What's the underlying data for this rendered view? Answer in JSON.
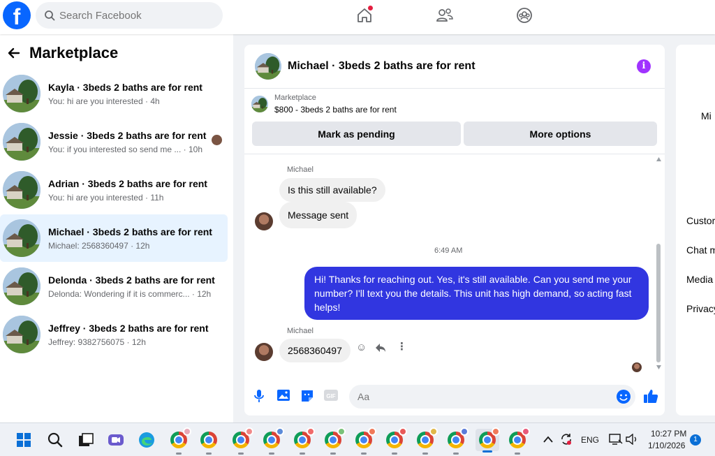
{
  "topbar": {
    "logo_text": "f",
    "search_placeholder": "Search Facebook",
    "nav_icons": [
      "home-icon",
      "friends-icon",
      "groups-icon"
    ]
  },
  "left": {
    "title": "Marketplace",
    "conversations": [
      {
        "title": "Kayla · 3beds 2 baths are for rent",
        "subtitle": "You: hi are you interested · 4h",
        "active": false
      },
      {
        "title": "Jessie · 3beds 2 baths are for rent",
        "subtitle": "You: if you interested so send me ... · 10h",
        "active": false
      },
      {
        "title": "Adrian · 3beds 2 baths are for rent",
        "subtitle": "You: hi are you interested · 11h",
        "active": false
      },
      {
        "title": "Michael · 3beds 2 baths are for rent",
        "subtitle": "Michael: 2568360497 · 12h",
        "active": true
      },
      {
        "title": "Delonda · 3beds 2 baths are for rent",
        "subtitle": "Delonda: Wondering if it is commerc... · 12h",
        "active": false
      },
      {
        "title": "Jeffrey · 3beds 2 baths are for rent",
        "subtitle": "Jeffrey: 9382756075 · 12h",
        "active": false
      }
    ]
  },
  "chat": {
    "title": "Michael · 3beds 2 baths are for rent",
    "listing_source": "Marketplace",
    "listing_text": "$800 - 3beds 2 baths are for rent",
    "mark_pending": "Mark as pending",
    "more_options": "More options",
    "messages": {
      "sender1": "Michael",
      "msg1": "Is this still available?",
      "msg2": "Message sent",
      "timestamp": "6:49 AM",
      "reply": "Hi! Thanks for reaching out. Yes, it's still available. Can you send me your number? I'll text you the details. This unit has high demand, so acting fast helps!",
      "sender2": "Michael",
      "msg3": "2568360497"
    },
    "input_placeholder": "Aa"
  },
  "right": {
    "name_partial": "Mi",
    "items": [
      "Custor",
      "Chat m",
      "Media",
      "Privacy"
    ]
  },
  "taskbar": {
    "lang": "ENG",
    "time": "10:27 PM",
    "date": "1/10/2026",
    "notifications": "1"
  },
  "colors": {
    "brand": "#0866ff",
    "my_bubble": "#3136e0",
    "active_row": "#e7f3ff",
    "info": "#a033ff"
  }
}
